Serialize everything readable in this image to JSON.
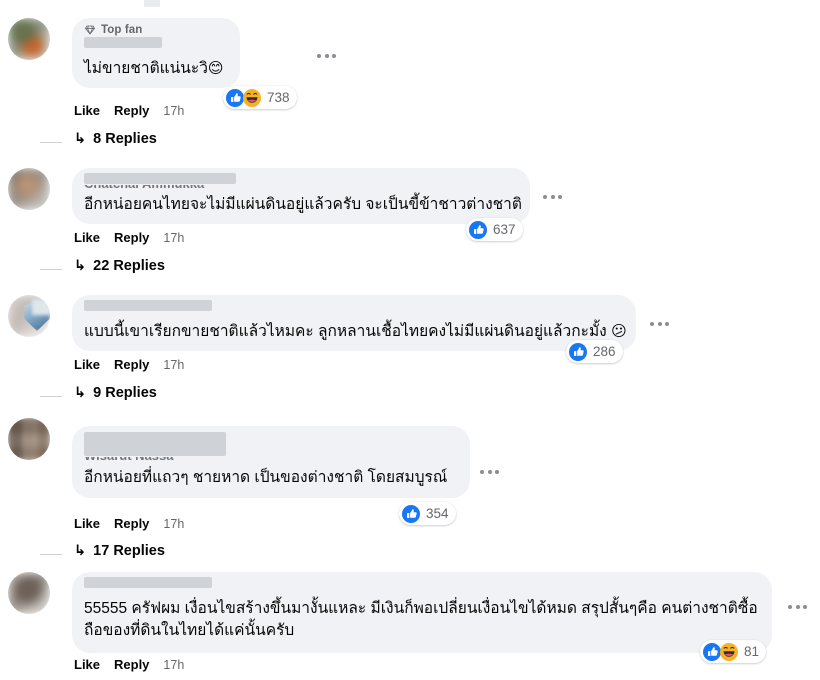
{
  "app": {
    "surface": "facebook-comments-thread",
    "background_color": "#ffffff",
    "bubble_color": "#f0f2f5",
    "text_color": "#050505",
    "muted_text_color": "#65676b",
    "accent_color": "#1877f2"
  },
  "actions": {
    "like_label": "Like",
    "reply_label": "Reply",
    "more_label": "...",
    "reply_arrow": "↳"
  },
  "reactions": {
    "like_icon": "thumbs-up-icon",
    "haha_icon": "haha-face-icon"
  },
  "comments": [
    {
      "id": "comment-1",
      "badge": {
        "icon": "gem-icon",
        "label": "Top fan"
      },
      "author_redacted": true,
      "author_ghost": "",
      "text": "ไม่ขายชาติแน่นะวิ",
      "text_emoji": "😊",
      "like_label": "Like",
      "reply_label": "Reply",
      "timestamp": "17h",
      "replies_count": "8 Replies",
      "reaction_count": "738",
      "reaction_types": [
        "like",
        "haha"
      ]
    },
    {
      "id": "comment-2",
      "badge": null,
      "author_redacted": true,
      "author_ghost": "Chatchai Ammukka",
      "text": "อีกหน่อยคนไทยจะไม่มีแผ่นดินอยู่แล้วครับ จะเป็นขี้ข้าชาวต่างชาติ",
      "text_emoji": "",
      "like_label": "Like",
      "reply_label": "Reply",
      "timestamp": "17h",
      "replies_count": "22 Replies",
      "reaction_count": "637",
      "reaction_types": [
        "like"
      ]
    },
    {
      "id": "comment-3",
      "badge": null,
      "author_redacted": true,
      "author_ghost": "",
      "text": "แบบนี้เขาเรียกขายชาติแล้วไหมคะ ลูกหลานเชื้อไทยคงไม่มีแผ่นดินอยู่แล้วกะมั้ง",
      "text_emoji": "😕",
      "like_label": "Like",
      "reply_label": "Reply",
      "timestamp": "17h",
      "replies_count": "9 Replies",
      "reaction_count": "286",
      "reaction_types": [
        "like"
      ]
    },
    {
      "id": "comment-4",
      "badge": null,
      "author_redacted": true,
      "author_ghost": "Wisarut Nassa",
      "text": "อีกหน่อยที่แถวๆ ชายหาด เป็นของต่างชาติ โดยสมบูรณ์",
      "text_emoji": "",
      "like_label": "Like",
      "reply_label": "Reply",
      "timestamp": "17h",
      "replies_count": "17 Replies",
      "reaction_count": "354",
      "reaction_types": [
        "like"
      ]
    },
    {
      "id": "comment-5",
      "badge": null,
      "author_redacted": true,
      "author_ghost": "",
      "text_line1": "55555 ครัฟผม เงื่อนไขสร้างขึ้นมางั้นแหละ มีเงินก็พอเปลี่ยนเงื่อนไขได้หมด สรุปสั้นๆคือ คนต่างชาติซื้อ",
      "text_line2": "ถือของที่ดินในไทยได้แค่นั้นครับ",
      "text_emoji": "",
      "like_label": "Like",
      "reply_label": "Reply",
      "timestamp": "17h",
      "replies_count": "",
      "reaction_count": "81",
      "reaction_types": [
        "like",
        "haha"
      ]
    }
  ]
}
